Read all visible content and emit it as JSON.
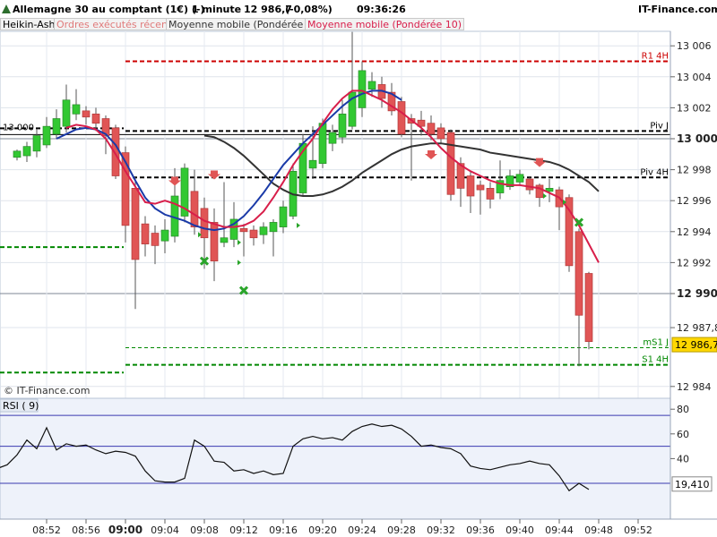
{
  "header": {
    "instrument": "Allemagne 30 au comptant (1€) (-)",
    "interval": "1 minute",
    "last_price": "12 986,7",
    "change": "(-0,08%)",
    "time": "09:36:26",
    "site": "IT-Finance.com"
  },
  "legend": {
    "heikin": "Heikin-Ashi",
    "orders": "Ordres exécutés récents",
    "mm30": "Moyenne mobile (Pondérée 30)",
    "mm10": "Moyenne mobile (Pondérée 10)"
  },
  "watermark": "© IT-Finance.com",
  "colors": {
    "bull": "#32c832",
    "bear": "#e05555",
    "mm10": "#d81e4a",
    "mm30": "#333333",
    "blue_ma": "#1a3aa8",
    "level_red": "#cc0000",
    "level_green": "#008800",
    "current_price_bg": "#ffd700"
  },
  "price_axis": {
    "ticks": [
      "13 006",
      "13 004",
      "13 002",
      "13 000",
      "12 998",
      "12 996",
      "12 994",
      "12 992",
      "12 990",
      "12 987,8",
      "12 984"
    ],
    "bold_ticks": [
      "13 000",
      "12 990"
    ],
    "current_label": "12 986,7"
  },
  "time_axis": {
    "ticks": [
      "08:52",
      "08:56",
      "09:00",
      "09:04",
      "09:08",
      "09:12",
      "09:16",
      "09:20",
      "09:24",
      "09:28",
      "09:32",
      "09:36",
      "09:40",
      "09:44",
      "09:48",
      "09:52"
    ],
    "bold_tick": "09:00"
  },
  "levels": [
    {
      "label": "R1 4H",
      "value": 13005.0,
      "color": "red"
    },
    {
      "label": "Piv J",
      "value": 13000.5,
      "color": "black"
    },
    {
      "label": "Piv 4H",
      "value": 12997.5,
      "color": "black"
    },
    {
      "label": "mS1 J",
      "value": 12986.5,
      "color": "green"
    },
    {
      "label": "S1 4H",
      "value": 12985.4,
      "color": "green"
    },
    {
      "label": "",
      "value": 12993.0,
      "color": "green"
    },
    {
      "label": "",
      "value": 12984.9,
      "color": "green"
    }
  ],
  "left_level_label": "13 000",
  "rsi": {
    "label": "RSI ( 9)",
    "ticks": [
      "80",
      "60",
      "40"
    ],
    "current": "19,410",
    "lines": [
      75,
      50,
      20
    ],
    "values": [
      32,
      35,
      43,
      55,
      48,
      65,
      47,
      52,
      50,
      51,
      47,
      44,
      46,
      45,
      42,
      30,
      22,
      21,
      21,
      24,
      55,
      50,
      38,
      37,
      30,
      31,
      28,
      30,
      27,
      28,
      50,
      56,
      58,
      56,
      57,
      55,
      62,
      66,
      68,
      66,
      67,
      64,
      58,
      50,
      51,
      49,
      48,
      44,
      34,
      32,
      31,
      33,
      35,
      36,
      38,
      36,
      35,
      26,
      14,
      20,
      15
    ]
  },
  "chart_data": {
    "type": "candlestick",
    "title": "Allemagne 30 au comptant (1€) (-)",
    "interval": "1 minute",
    "x_start": "08:49",
    "x_step_minutes": 1,
    "ylim": [
      12983.0,
      13008.0
    ],
    "candles": [
      {
        "o": 12998.8,
        "c": 12999.2,
        "h": 12999.3,
        "l": 12998.6
      },
      {
        "o": 12998.9,
        "c": 12999.5,
        "h": 12999.8,
        "l": 12998.5
      },
      {
        "o": 12999.2,
        "c": 13000.2,
        "h": 13000.6,
        "l": 12998.8
      },
      {
        "o": 12999.6,
        "c": 13000.8,
        "h": 13001.4,
        "l": 12999.4
      },
      {
        "o": 13000.3,
        "c": 13001.3,
        "h": 13001.9,
        "l": 13000.0
      },
      {
        "o": 13000.8,
        "c": 13002.5,
        "h": 13003.5,
        "l": 13000.4
      },
      {
        "o": 13001.6,
        "c": 13002.2,
        "h": 13003.2,
        "l": 13001.2
      },
      {
        "o": 13001.8,
        "c": 13001.4,
        "h": 13002.1,
        "l": 13000.9
      },
      {
        "o": 13001.6,
        "c": 13001.0,
        "h": 13002.0,
        "l": 13000.5
      },
      {
        "o": 13001.3,
        "c": 13000.2,
        "h": 13001.5,
        "l": 12999.0
      },
      {
        "o": 13000.7,
        "c": 12997.6,
        "h": 13000.9,
        "l": 12997.4
      },
      {
        "o": 12999.1,
        "c": 12994.4,
        "h": 12999.5,
        "l": 12993.3
      },
      {
        "o": 12996.8,
        "c": 12992.2,
        "h": 12997.5,
        "l": 12989.0
      },
      {
        "o": 12994.5,
        "c": 12993.2,
        "h": 12995.0,
        "l": 12992.4
      },
      {
        "o": 12993.9,
        "c": 12993.1,
        "h": 12994.4,
        "l": 12991.9
      },
      {
        "o": 12993.4,
        "c": 12994.1,
        "h": 12994.8,
        "l": 12992.6
      },
      {
        "o": 12993.7,
        "c": 12996.3,
        "h": 12998.1,
        "l": 12993.3
      },
      {
        "o": 12995.0,
        "c": 12998.1,
        "h": 12998.4,
        "l": 12994.6
      },
      {
        "o": 12996.6,
        "c": 12994.3,
        "h": 12998.0,
        "l": 12993.8
      },
      {
        "o": 12995.5,
        "c": 12993.6,
        "h": 12996.2,
        "l": 12991.6
      },
      {
        "o": 12994.6,
        "c": 12992.1,
        "h": 12995.5,
        "l": 12990.8
      },
      {
        "o": 12993.3,
        "c": 12993.6,
        "h": 12997.2,
        "l": 12993.0
      },
      {
        "o": 12993.5,
        "c": 12994.8,
        "h": 12995.9,
        "l": 12993.0
      },
      {
        "o": 12994.2,
        "c": 12994.0,
        "h": 12994.5,
        "l": 12992.4
      },
      {
        "o": 12994.1,
        "c": 12993.6,
        "h": 12994.4,
        "l": 12993.1
      },
      {
        "o": 12993.8,
        "c": 12994.3,
        "h": 12994.6,
        "l": 12993.2
      },
      {
        "o": 12994.0,
        "c": 12994.6,
        "h": 12994.8,
        "l": 12992.4
      },
      {
        "o": 12994.3,
        "c": 12995.6,
        "h": 12996.0,
        "l": 12993.9
      },
      {
        "o": 12995.0,
        "c": 12997.9,
        "h": 12998.4,
        "l": 12994.8
      },
      {
        "o": 12996.5,
        "c": 12999.7,
        "h": 13000.3,
        "l": 12996.3
      },
      {
        "o": 12998.1,
        "c": 12998.6,
        "h": 13000.8,
        "l": 12997.4
      },
      {
        "o": 12998.4,
        "c": 13001.0,
        "h": 13001.3,
        "l": 12998.1
      },
      {
        "o": 12999.7,
        "c": 13000.4,
        "h": 13000.9,
        "l": 12999.2
      },
      {
        "o": 13000.1,
        "c": 13001.6,
        "h": 13002.5,
        "l": 12999.7
      },
      {
        "o": 13000.8,
        "c": 13003.0,
        "h": 13006.9,
        "l": 13000.6
      },
      {
        "o": 13002.0,
        "c": 13004.4,
        "h": 13005.0,
        "l": 13001.4
      },
      {
        "o": 13003.2,
        "c": 13003.7,
        "h": 13004.3,
        "l": 13002.7
      },
      {
        "o": 13003.5,
        "c": 13002.6,
        "h": 13004.0,
        "l": 13002.0
      },
      {
        "o": 13003.0,
        "c": 13001.8,
        "h": 13003.6,
        "l": 13001.5
      },
      {
        "o": 13002.4,
        "c": 13000.3,
        "h": 13002.7,
        "l": 13000.1
      },
      {
        "o": 13001.3,
        "c": 13001.0,
        "h": 13001.6,
        "l": 12997.3
      },
      {
        "o": 13001.2,
        "c": 13000.8,
        "h": 13001.8,
        "l": 13000.2
      },
      {
        "o": 13001.0,
        "c": 13000.3,
        "h": 13001.5,
        "l": 12999.9
      },
      {
        "o": 13000.7,
        "c": 13000.0,
        "h": 13001.0,
        "l": 12999.7
      },
      {
        "o": 13000.4,
        "c": 12996.4,
        "h": 13000.6,
        "l": 12996.0
      },
      {
        "o": 12998.4,
        "c": 12996.8,
        "h": 12998.8,
        "l": 12995.6
      },
      {
        "o": 12997.6,
        "c": 12996.3,
        "h": 12997.9,
        "l": 12995.2
      },
      {
        "o": 12997.0,
        "c": 12996.7,
        "h": 12997.3,
        "l": 12995.1
      },
      {
        "o": 12996.8,
        "c": 12996.1,
        "h": 12997.2,
        "l": 12995.5
      },
      {
        "o": 12996.5,
        "c": 12997.3,
        "h": 12998.6,
        "l": 12996.1
      },
      {
        "o": 12996.9,
        "c": 12997.6,
        "h": 12998.0,
        "l": 12996.7
      },
      {
        "o": 12997.2,
        "c": 12997.7,
        "h": 12998.0,
        "l": 12997.0
      },
      {
        "o": 12997.4,
        "c": 12996.7,
        "h": 12997.5,
        "l": 12996.4
      },
      {
        "o": 12997.0,
        "c": 12996.2,
        "h": 12997.1,
        "l": 12995.6
      },
      {
        "o": 12996.6,
        "c": 12996.8,
        "h": 12997.4,
        "l": 12995.9
      },
      {
        "o": 12996.7,
        "c": 12995.6,
        "h": 12996.9,
        "l": 12994.1
      },
      {
        "o": 12996.2,
        "c": 12991.8,
        "h": 12996.4,
        "l": 12991.4
      },
      {
        "o": 12994.0,
        "c": 12988.6,
        "h": 12994.2,
        "l": 12985.3
      },
      {
        "o": 12991.3,
        "c": 12986.9,
        "h": 12991.4,
        "l": 12986.4
      }
    ],
    "mm10": [
      13000.7,
      13000.9,
      13000.8,
      13000.6,
      13000.0,
      12999.0,
      12997.9,
      12996.9,
      12995.9,
      12995.8,
      12996.0,
      12995.8,
      12995.5,
      12995.1,
      12994.7,
      12994.5,
      12994.3,
      12994.3,
      12994.4,
      12994.7,
      12995.3,
      12996.2,
      12997.2,
      12998.3,
      12999.2,
      13000.0,
      13001.0,
      13001.9,
      13002.6,
      13003.1,
      13003.1,
      13002.8,
      13002.5,
      13002.1,
      13001.7,
      13001.2,
      13000.7,
      13000.1,
      12999.4,
      12998.8,
      12998.3,
      12997.9,
      12997.6,
      12997.3,
      12997.1,
      12997.0,
      12997.0,
      12996.9,
      12996.8,
      12996.5,
      12996.2,
      12995.4,
      12994.4,
      12993.2,
      12992.0
    ],
    "mm30": [
      13000.2,
      13000.1,
      12999.8,
      12999.4,
      12998.9,
      12998.3,
      12997.7,
      12997.1,
      12996.7,
      12996.4,
      12996.3,
      12996.3,
      12996.4,
      12996.6,
      12996.9,
      12997.3,
      12997.8,
      12998.2,
      12998.6,
      12999.0,
      12999.3,
      12999.5,
      12999.6,
      12999.7,
      12999.7,
      12999.6,
      12999.5,
      12999.4,
      12999.3,
      12999.1,
      12999.0,
      12998.9,
      12998.8,
      12998.7,
      12998.6,
      12998.5,
      12998.3,
      12998.0,
      12997.6,
      12997.2,
      12996.6
    ],
    "blue_ma": [
      13000.0,
      13000.3,
      13000.6,
      13000.7,
      13000.6,
      13000.3,
      12999.6,
      12998.5,
      12997.3,
      12996.2,
      12995.5,
      12995.1,
      12994.9,
      12994.7,
      12994.4,
      12994.2,
      12994.1,
      12994.2,
      12994.5,
      12995.0,
      12995.7,
      12996.5,
      12997.4,
      12998.3,
      12999.0,
      12999.7,
      13000.3,
      13000.9,
      13001.5,
      13002.1,
      13002.6,
      13002.9,
      13003.1,
      13003.1,
      13002.9,
      13002.5
    ]
  }
}
